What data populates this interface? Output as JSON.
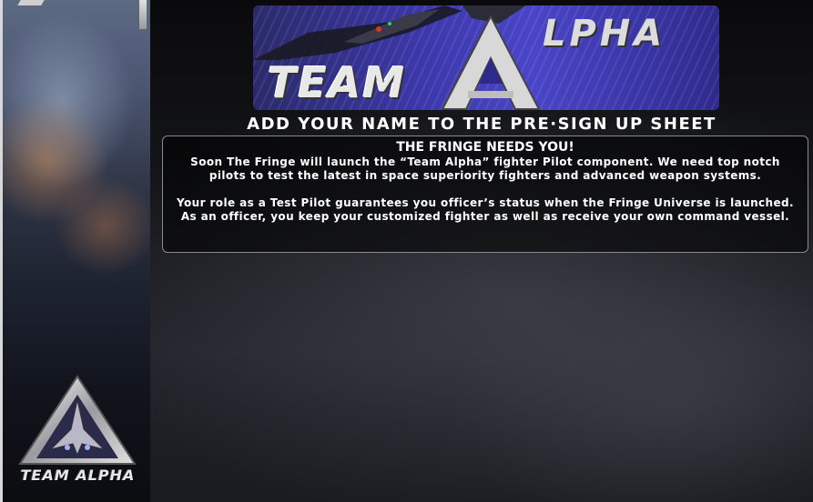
{
  "banner": {
    "word_team": "TEAM",
    "letter_a": "A",
    "word_lpha": "LPHA"
  },
  "headline": "ADD YOUR NAME TO THE PRE·SIGN UP SHEET",
  "info_box": {
    "title": "THE FRINGE NEEDS YOU!",
    "paragraphs": [
      "Soon The Fringe will launch the “Team Alpha” fighter Pilot component. We need top notch pilots to test the latest in space superiority fighters and advanced weapon systems.",
      "Your role as a Test Pilot guarantees you officer’s status when the Fringe Universe is launched. As an officer, you keep your customized fighter as well as receive your own command vessel."
    ]
  },
  "sidebar": {
    "logo_text": "TEAM ALPHA"
  },
  "colors": {
    "banner_blue": "#3b37a8",
    "text": "#ffffff",
    "box_border": "#8a8a90"
  }
}
